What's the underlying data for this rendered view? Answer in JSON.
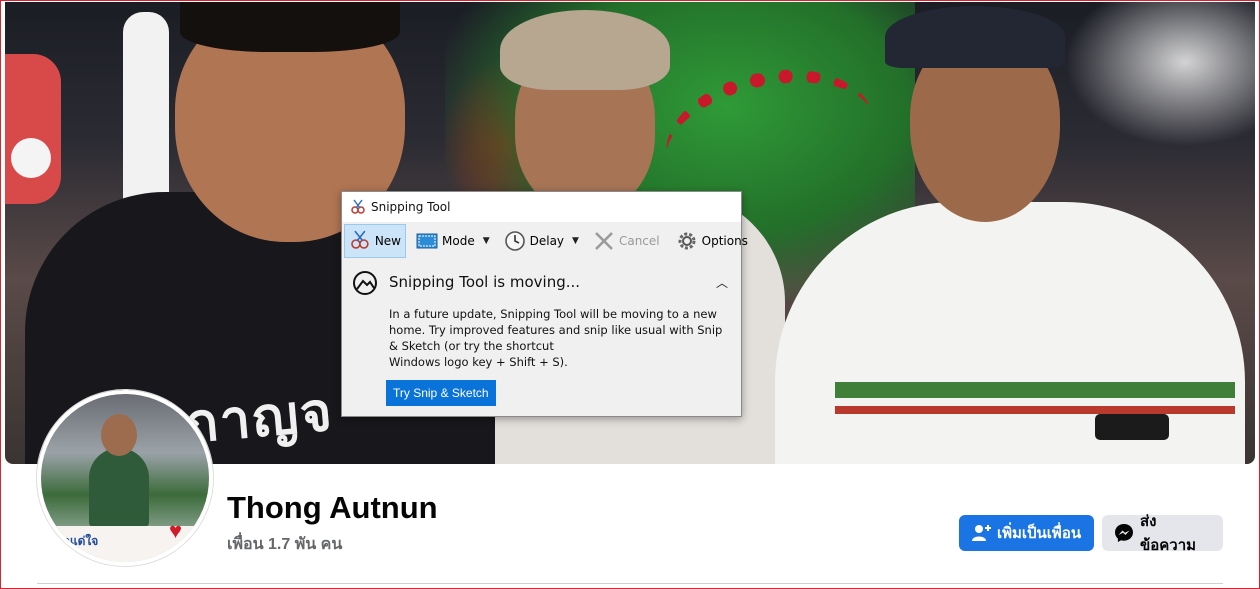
{
  "profile": {
    "name": "Thong Autnun",
    "friends": "เพื่อน 1.7 พัน คน"
  },
  "cover_photo": {
    "shirt_text": "กาญจ"
  },
  "avatar_photo": {
    "banner_text": "บกแด่ใจ"
  },
  "actions": {
    "add_friend_label": "เพิ่มเป็นเพื่อน",
    "message_label": "ส่งข้อความ"
  },
  "colors": {
    "primary_button": "#1b74e4",
    "secondary_button": "#e4e6eb",
    "window_border": "#d9232e"
  },
  "snipping_tool": {
    "title": "Snipping Tool",
    "toolbar": {
      "new_label": "New",
      "mode_label": "Mode",
      "delay_label": "Delay",
      "cancel_label": "Cancel",
      "options_label": "Options"
    },
    "notice": {
      "heading": "Snipping Tool is moving...",
      "lines": [
        "In a future update, Snipping Tool will be moving to a new",
        "home. Try improved features and snip like usual with Snip",
        "& Sketch (or try the shortcut",
        "Windows logo key + Shift + S)."
      ],
      "button_label": "Try Snip & Sketch"
    }
  }
}
